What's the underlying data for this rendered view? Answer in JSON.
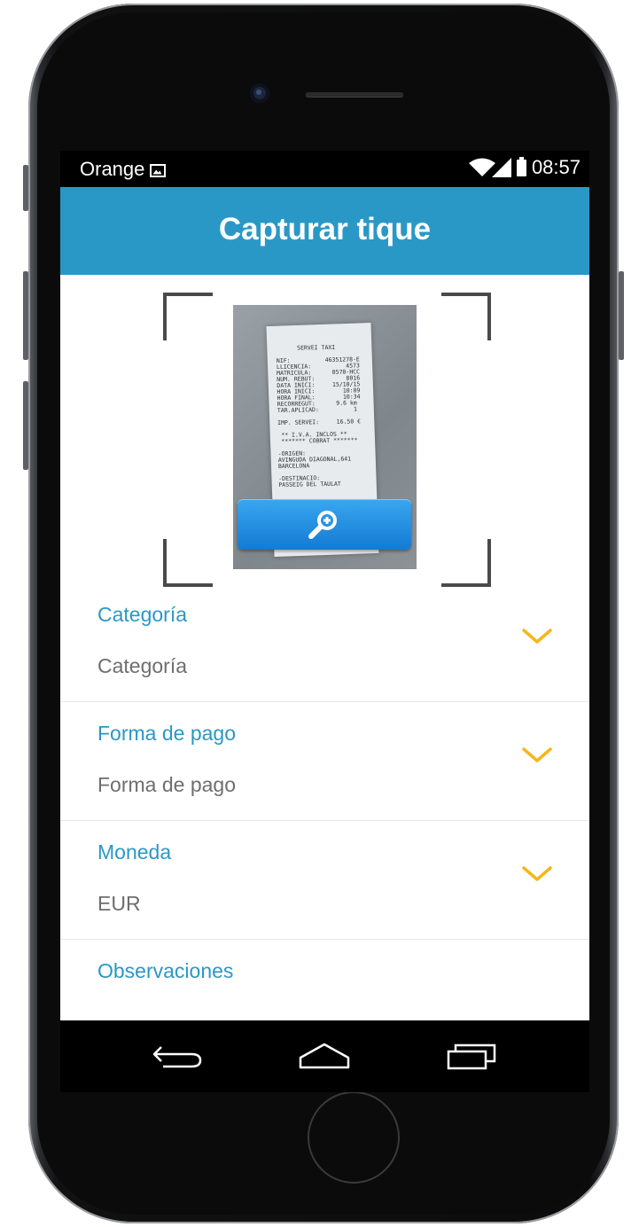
{
  "status_bar": {
    "carrier": "Orange",
    "time": "08:57",
    "icons": [
      "image-icon",
      "wifi-icon",
      "signal-icon",
      "battery-icon"
    ]
  },
  "app_bar": {
    "title": "Capturar tique",
    "color": "#2a98c6"
  },
  "capture": {
    "receipt_lines": "      SERVEI TAXI\n\nNIF:          46351278-E\nLLICENCIA:          4573\nMATRICULA:      0570-HCC\nNUM. REBUT:         8016\nDATA INICI:     15/10/15\nHORA INICI:        10:09\nHORA FINAL:        10:34\nRECORREGUT:      9.6 km\nTAR.APLICAD:          1\n\nIMP. SERVEI:     16.50 €\n\n ** I.V.A. INCLOS **\n ******* COBRAT *******\n\n-ORIGEN:\nAVINGUDA DIAGONAL,641\nBARCELONA\n\n-DESTINACIO:\nPASSEIG DEL TAULAT",
    "zoom_icon": "zoom-in-icon"
  },
  "form": {
    "fields": [
      {
        "label": "Categoría",
        "value": "Categoría"
      },
      {
        "label": "Forma de pago",
        "value": "Forma de pago"
      },
      {
        "label": "Moneda",
        "value": "EUR"
      },
      {
        "label": "Observaciones",
        "value": ""
      }
    ],
    "chevron_color": "#f5b71a"
  },
  "nav_bar": {
    "icons": [
      "back-icon",
      "home-icon",
      "recents-icon"
    ]
  }
}
